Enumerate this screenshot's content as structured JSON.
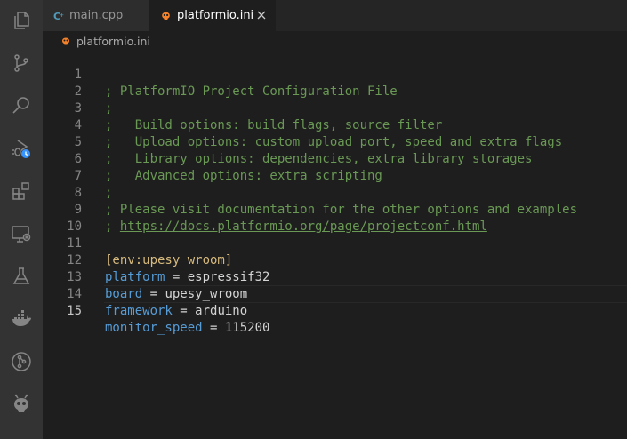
{
  "activity_bar": {
    "items": [
      {
        "icon": "explorer-icon"
      },
      {
        "icon": "source-control-icon"
      },
      {
        "icon": "search-icon"
      },
      {
        "icon": "run-debug-icon"
      },
      {
        "icon": "extensions-icon"
      },
      {
        "icon": "remote-explorer-icon"
      },
      {
        "icon": "testing-icon"
      },
      {
        "icon": "docker-icon"
      },
      {
        "icon": "git-graph-icon"
      },
      {
        "icon": "platformio-icon"
      }
    ]
  },
  "tabs": [
    {
      "label": "main.cpp",
      "icon": "cpp-file-icon",
      "active": false
    },
    {
      "label": "platformio.ini",
      "icon": "platformio-file-icon",
      "active": true
    }
  ],
  "breadcrumb": {
    "file": "platformio.ini"
  },
  "editor": {
    "current_line": 15,
    "lines": [
      {
        "num": "1",
        "text": "; PlatformIO Project Configuration File"
      },
      {
        "num": "2",
        "text": ";"
      },
      {
        "num": "3",
        "text": ";   Build options: build flags, source filter"
      },
      {
        "num": "4",
        "text": ";   Upload options: custom upload port, speed and extra flags"
      },
      {
        "num": "5",
        "text": ";   Library options: dependencies, extra library storages"
      },
      {
        "num": "6",
        "text": ";   Advanced options: extra scripting"
      },
      {
        "num": "7",
        "text": ";"
      },
      {
        "num": "8",
        "text": "; Please visit documentation for the other options and examples"
      },
      {
        "num": "9",
        "prefix": "; ",
        "link": "https://docs.platformio.org/page/projectconf.html"
      },
      {
        "num": "10",
        "text": ""
      },
      {
        "num": "11",
        "section": "[env:upesy_wroom]"
      },
      {
        "num": "12",
        "key": "platform",
        "value": "espressif32"
      },
      {
        "num": "13",
        "key": "board",
        "value": "upesy_wroom"
      },
      {
        "num": "14",
        "key": "framework",
        "value": "arduino"
      },
      {
        "num": "15",
        "key": "monitor_speed",
        "value": "115200"
      }
    ]
  },
  "colors": {
    "comment": "#6a9955",
    "key": "#569cd6",
    "section": "#d7ba7d",
    "accent_debug_badge": "#3794ff",
    "platformio_orange": "#f5822a"
  }
}
